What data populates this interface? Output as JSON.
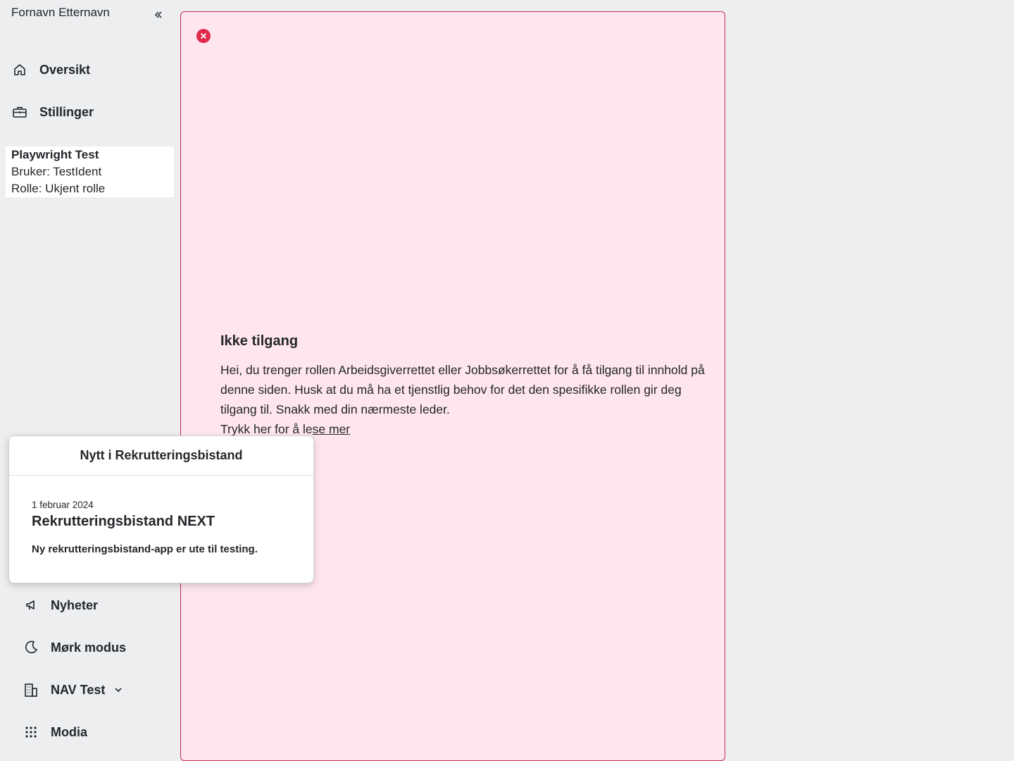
{
  "sidebar": {
    "user_name": "Fornavn Etternavn",
    "collapse_icon": "chevron-double-left-icon",
    "top_items": [
      {
        "label": "Oversikt",
        "icon": "house-icon"
      },
      {
        "label": "Stillinger",
        "icon": "briefcase-icon"
      }
    ],
    "info": {
      "name": "Playwright Test",
      "user": "Bruker: TestIdent",
      "role": "Rolle: Ukjent rolle"
    },
    "bottom_items": [
      {
        "label": "Nyheter",
        "icon": "megaphone-icon"
      },
      {
        "label": "Mørk modus",
        "icon": "moon-icon"
      },
      {
        "label": "NAV Test",
        "icon": "buildings-icon"
      },
      {
        "label": "Modia",
        "icon": "grid-icon"
      }
    ]
  },
  "alert": {
    "heading": "Ikke tilgang",
    "body": "Hei, du trenger rollen Arbeidsgiverrettet eller Jobbsøkerrettet for å få tilgang til innhold på denne siden. Husk at du må ha et tjenstlig behov for det den spesifikke rollen gir deg tilgang til. Snakk med din nærmeste leder.",
    "link_prefix": "Trykk her for å le",
    "link_text": "se mer",
    "icon": "x-circle-icon",
    "border_color": "#c3314c",
    "background": "#ffe6ee"
  },
  "news_popover": {
    "header": "Nytt i Rekrutteringsbistand",
    "date": "1 februar 2024",
    "title": "Rekrutteringsbistand NEXT",
    "text": "Ny rekrutteringsbistand-app er ute til testing."
  }
}
